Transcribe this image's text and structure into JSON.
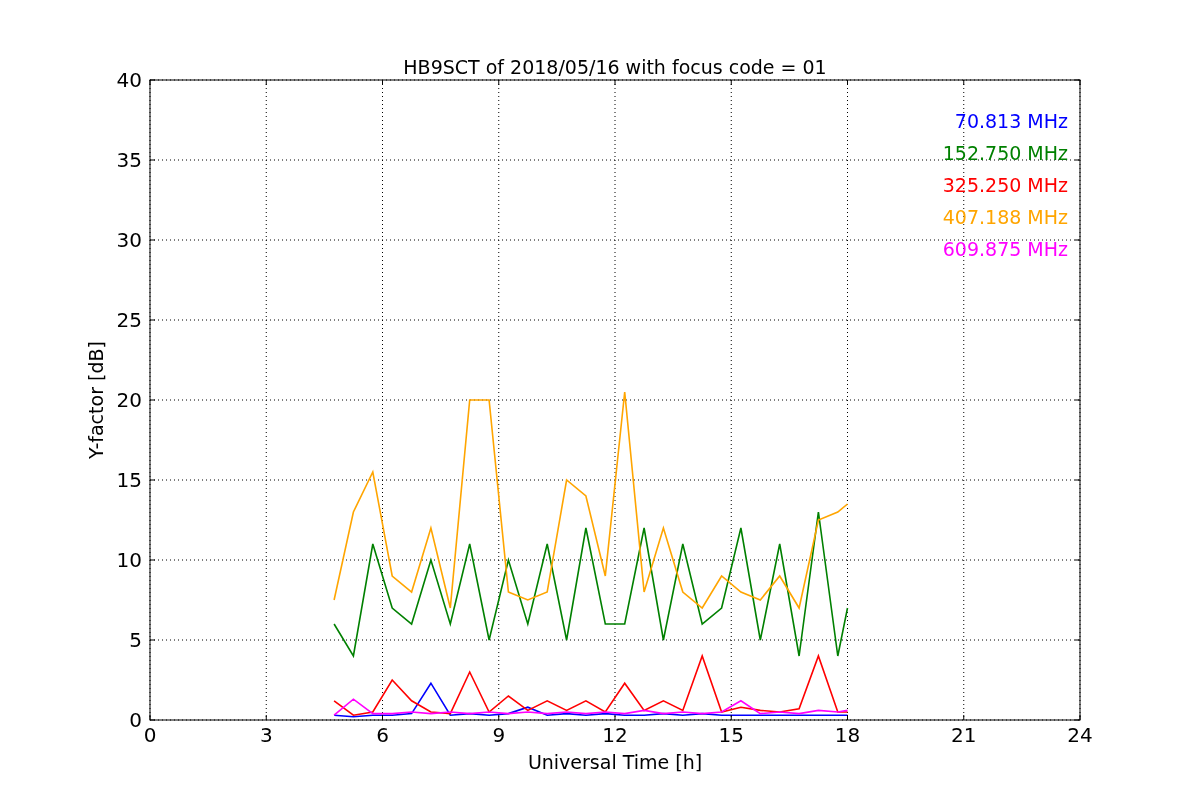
{
  "chart": {
    "chart_data": {
      "type": "line",
      "title": "HB9SCT of 2018/05/16 with focus code = 01",
      "xlabel": "Universal Time [h]",
      "ylabel": "Y-factor [dB]",
      "x": [
        4.75,
        5.25,
        5.75,
        6.25,
        6.75,
        7.25,
        7.75,
        8.25,
        8.75,
        9.25,
        9.75,
        10.25,
        10.75,
        11.25,
        11.75,
        12.25,
        12.75,
        13.25,
        13.75,
        14.25,
        14.75,
        15.25,
        15.75,
        16.25,
        16.75,
        17.25,
        17.75,
        18.0
      ],
      "xlim": [
        0,
        24
      ],
      "ylim": [
        0,
        40
      ],
      "grid": true,
      "xticks": [
        0,
        3,
        6,
        9,
        12,
        15,
        18,
        21,
        24
      ],
      "yticks": [
        0,
        5,
        10,
        15,
        20,
        25,
        30,
        35,
        40
      ],
      "series": [
        {
          "name": "70.813 MHz",
          "color": "#0000ff",
          "values": [
            0.3,
            0.2,
            0.3,
            0.3,
            0.4,
            2.3,
            0.3,
            0.4,
            0.3,
            0.4,
            0.8,
            0.3,
            0.4,
            0.3,
            0.4,
            0.3,
            0.3,
            0.4,
            0.3,
            0.4,
            0.3,
            0.3,
            0.3,
            0.3,
            0.3,
            0.3,
            0.3,
            0.3
          ]
        },
        {
          "name": "152.750 MHz",
          "color": "#008000",
          "values": [
            6,
            4,
            11,
            7,
            6,
            10,
            6,
            11,
            5,
            10,
            6,
            11,
            5,
            12,
            6,
            6,
            12,
            5,
            11,
            6,
            7,
            12,
            5,
            11,
            4,
            13,
            4,
            7
          ]
        },
        {
          "name": "325.250 MHz",
          "color": "#ff0000",
          "values": [
            1.2,
            0.3,
            0.5,
            2.5,
            1.2,
            0.5,
            0.4,
            3,
            0.5,
            1.5,
            0.6,
            1.2,
            0.6,
            1.2,
            0.5,
            2.3,
            0.6,
            1.2,
            0.6,
            4,
            0.5,
            0.8,
            0.6,
            0.5,
            0.7,
            4,
            0.5,
            0.5
          ]
        },
        {
          "name": "407.188 MHz",
          "color": "#ffa500",
          "values": [
            7.5,
            13,
            15.5,
            9,
            8,
            12,
            7,
            20,
            20,
            8,
            7.5,
            8,
            15,
            14,
            9,
            20.5,
            8,
            12,
            8,
            7,
            9,
            8,
            7.5,
            9,
            7,
            12.5,
            13,
            13.5
          ]
        },
        {
          "name": "609.875 MHz",
          "color": "#ff00ff",
          "values": [
            0.3,
            1.3,
            0.4,
            0.4,
            0.5,
            0.4,
            0.5,
            0.4,
            0.5,
            0.4,
            0.5,
            0.4,
            0.5,
            0.4,
            0.5,
            0.4,
            0.6,
            0.4,
            0.5,
            0.4,
            0.5,
            1.2,
            0.4,
            0.5,
            0.4,
            0.6,
            0.5,
            0.6
          ]
        }
      ]
    }
  }
}
